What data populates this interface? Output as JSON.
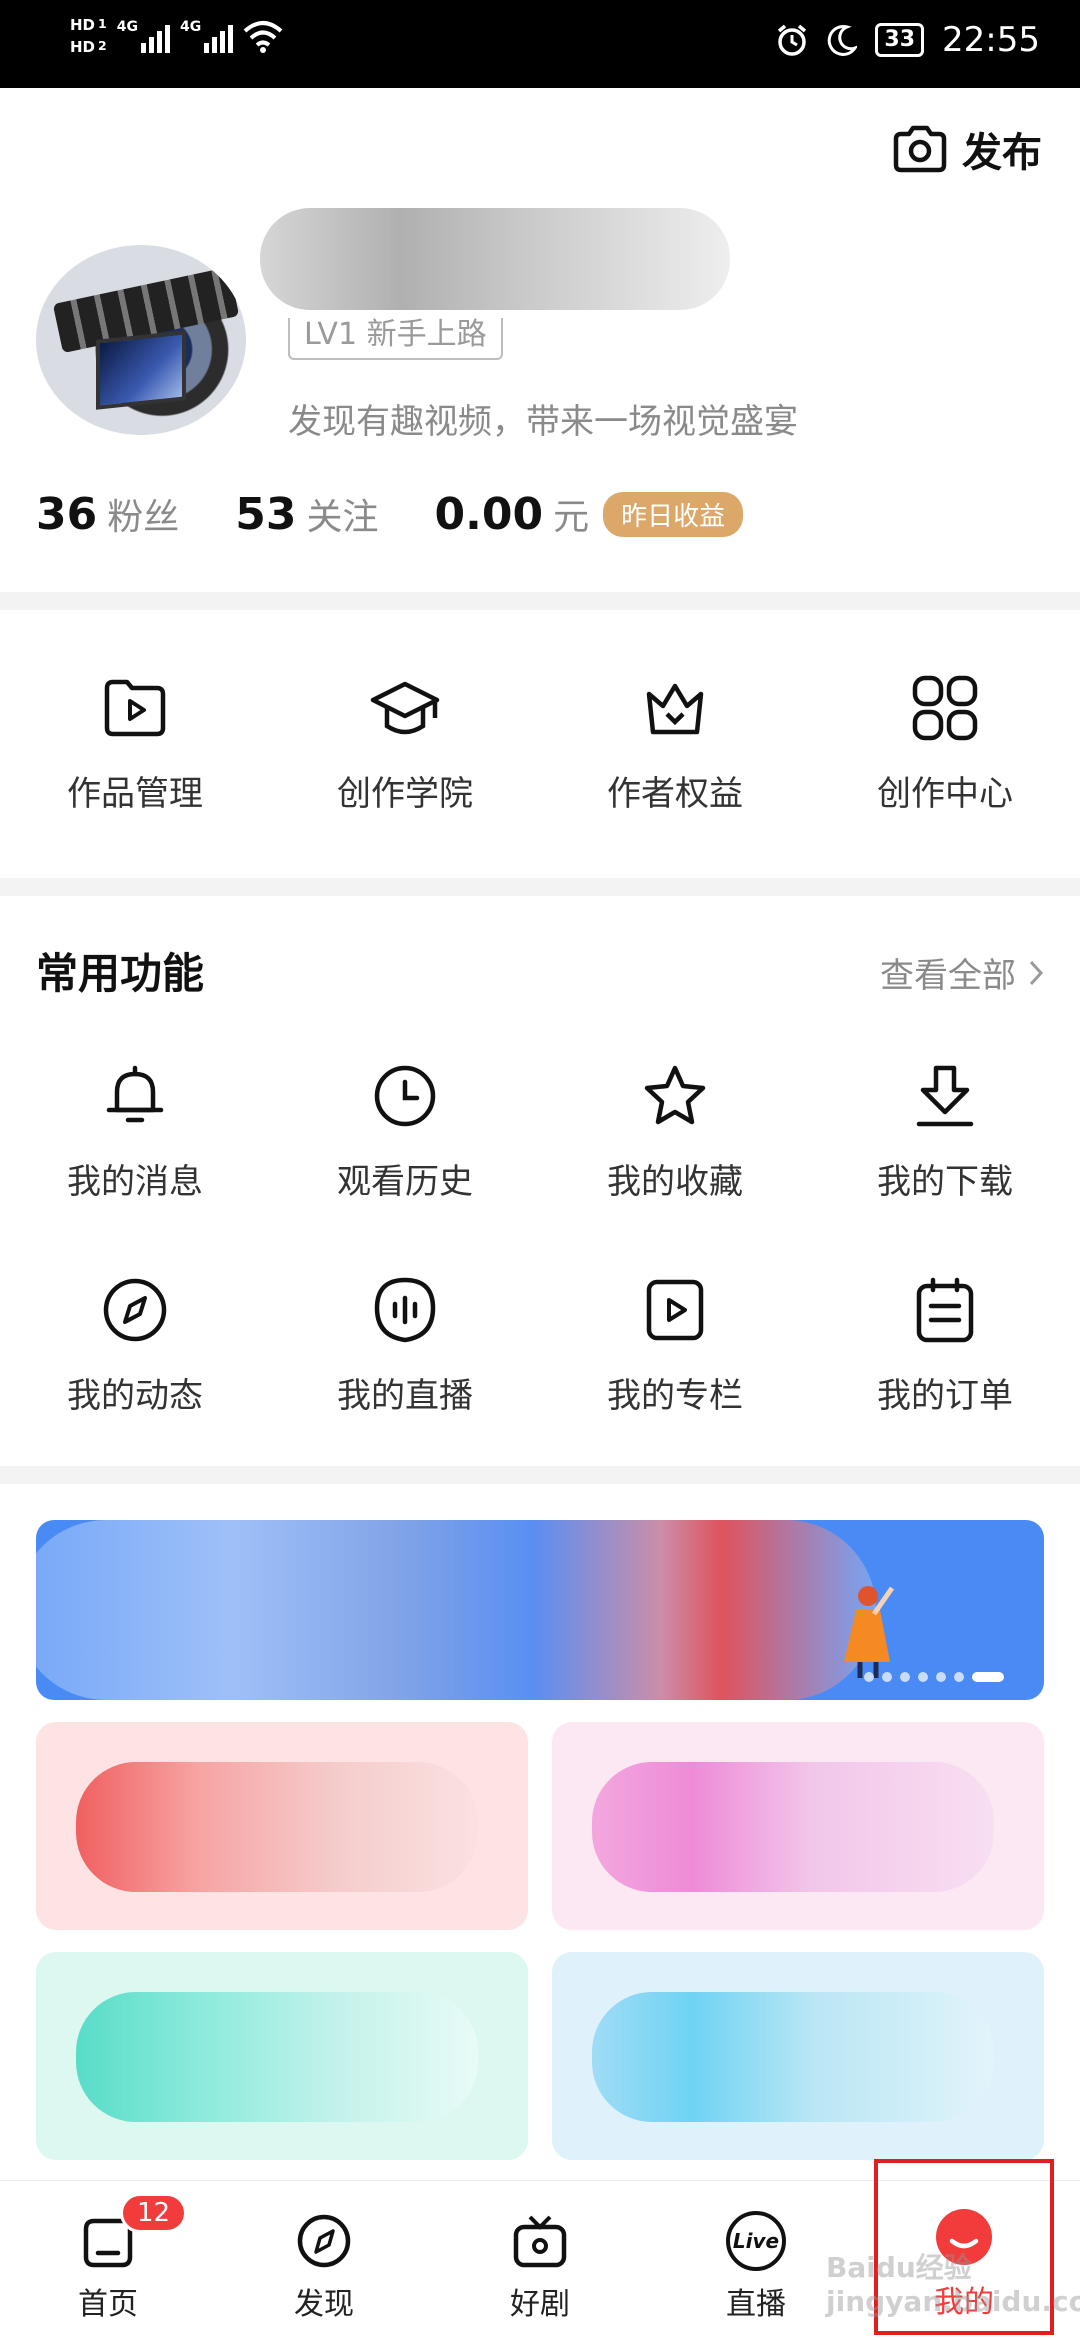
{
  "status_bar": {
    "hd1": "HD",
    "hd1_sub": "1",
    "hd2": "HD",
    "hd2_sub": "2",
    "net1": "4G",
    "net2": "4G",
    "battery": "33",
    "time": "22:55"
  },
  "header": {
    "publish_label": "发布",
    "level_badge": "LV1 新手上路",
    "bio": "发现有趣视频，带来一场视觉盛宴"
  },
  "stats": {
    "fans_value": "36",
    "fans_label": "粉丝",
    "follow_value": "53",
    "follow_label": "关注",
    "earn_value": "0.00",
    "earn_unit": "元",
    "earn_badge": "昨日收益"
  },
  "creation_tools": [
    {
      "label": "作品管理",
      "icon": "play-folder-icon"
    },
    {
      "label": "创作学院",
      "icon": "graduation-cap-icon"
    },
    {
      "label": "作者权益",
      "icon": "crown-icon"
    },
    {
      "label": "创作中心",
      "icon": "grid-icon"
    }
  ],
  "common": {
    "title": "常用功能",
    "view_all": "查看全部"
  },
  "functions": [
    {
      "label": "我的消息",
      "icon": "bell-icon"
    },
    {
      "label": "观看历史",
      "icon": "clock-icon"
    },
    {
      "label": "我的收藏",
      "icon": "star-icon"
    },
    {
      "label": "我的下载",
      "icon": "download-icon"
    },
    {
      "label": "我的动态",
      "icon": "compass-icon"
    },
    {
      "label": "我的直播",
      "icon": "voice-icon"
    },
    {
      "label": "我的专栏",
      "icon": "play-box-icon"
    },
    {
      "label": "我的订单",
      "icon": "order-icon"
    }
  ],
  "banner": {
    "dot_count": 7,
    "active_dot": 6
  },
  "tabbar": {
    "items": [
      {
        "label": "首页",
        "icon": "home-icon",
        "badge": "12"
      },
      {
        "label": "发现",
        "icon": "compass-icon"
      },
      {
        "label": "好剧",
        "icon": "tv-icon"
      },
      {
        "label": "直播",
        "icon": "live-icon",
        "icon_text": "Live"
      },
      {
        "label": "我的",
        "icon": "profile-icon"
      }
    ],
    "active_index": 4
  },
  "colors": {
    "accent_red": "#f23b3b",
    "earn_badge": "#dca86a",
    "banner_blue": "#4a8af4",
    "highlight_box": "#e02020"
  },
  "watermark": "Baidu经验 jingyan.baidu.com"
}
